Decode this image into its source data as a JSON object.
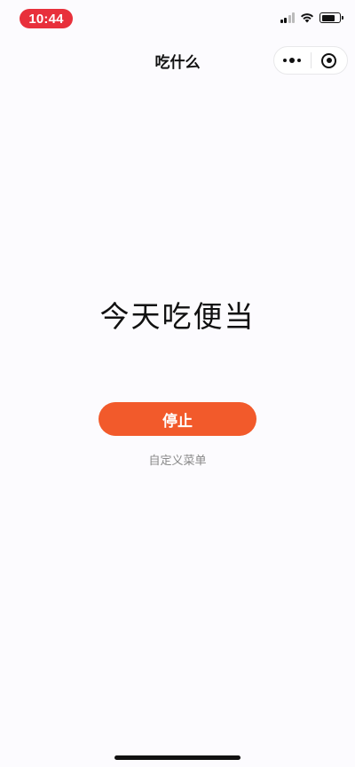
{
  "status_bar": {
    "time": "10:44"
  },
  "nav": {
    "title": "吃什么"
  },
  "main": {
    "result_text": "今天吃便当",
    "stop_button_label": "停止",
    "custom_menu_link": "自定义菜单"
  },
  "colors": {
    "accent": "#f25a2b",
    "time_pill": "#e8303b"
  }
}
